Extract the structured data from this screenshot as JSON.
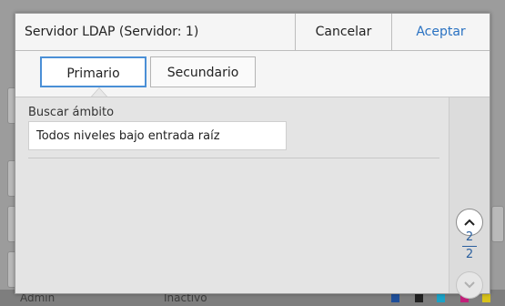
{
  "dialog": {
    "title": "Servidor LDAP (Servidor: 1)",
    "cancel_label": "Cancelar",
    "accept_label": "Aceptar"
  },
  "tabs": [
    {
      "label": "Primario",
      "active": true
    },
    {
      "label": "Secundario",
      "active": false
    }
  ],
  "search_scope": {
    "label": "Buscar ámbito",
    "value": "Todos niveles bajo entrada raíz"
  },
  "pagination": {
    "current": "2",
    "total": "2",
    "up_icon": "chevron-up-icon",
    "down_icon": "chevron-down-icon"
  },
  "background": {
    "user_text": "Admin",
    "status_text": "Inactivo"
  },
  "colors": {
    "accent": "#2a72c2",
    "tab_active_border": "#4a8fd6",
    "page_number": "#2a5f9e"
  }
}
